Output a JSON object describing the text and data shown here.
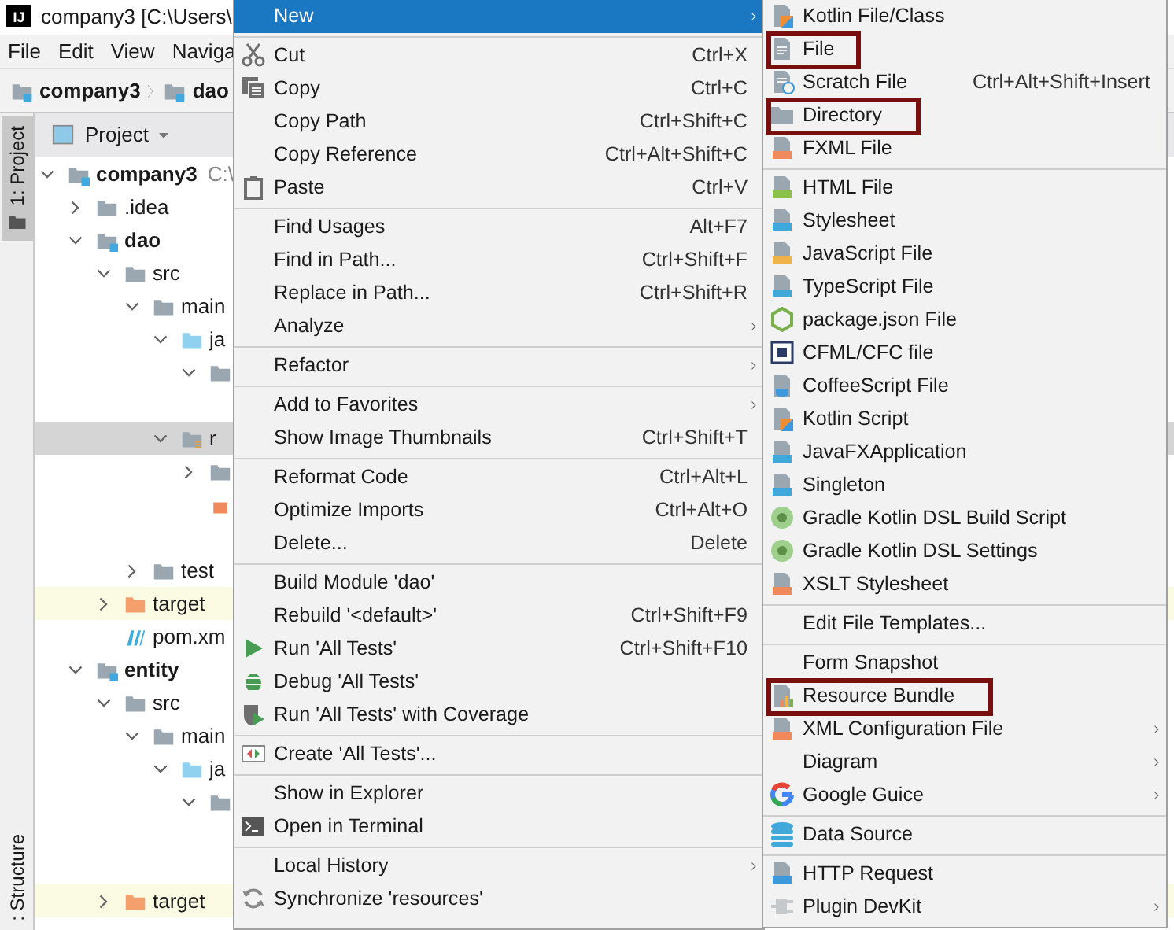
{
  "window": {
    "logo": "IJ",
    "title": "company3 [C:\\Users\\"
  },
  "menubar": [
    "File",
    "Edit",
    "View",
    "Naviga"
  ],
  "breadcrumb": [
    "company3",
    "dao"
  ],
  "tool_windows": [
    {
      "label": "1: Project",
      "selected": true
    },
    {
      "label": ": Structure",
      "selected": false
    }
  ],
  "project_panel": {
    "title": "Project"
  },
  "tree": [
    {
      "label": "company3",
      "suffix": "C:\\",
      "kind": "module",
      "expanded": true,
      "selected": false,
      "children": [
        {
          "label": ".idea",
          "kind": "folder",
          "expanded": false,
          "selected": false
        },
        {
          "label": "dao",
          "kind": "module",
          "expanded": true,
          "selected": false,
          "children": [
            {
              "label": "src",
              "kind": "folder",
              "expanded": true,
              "selected": false,
              "children": [
                {
                  "label": "main",
                  "kind": "folder",
                  "expanded": true,
                  "selected": false,
                  "children": [
                    {
                      "label": "ja",
                      "kind": "source",
                      "expanded": true,
                      "selected": false,
                      "children": [
                        {
                          "kind": "folder",
                          "expanded": true,
                          "selected": false,
                          "children": [
                            {
                              "selected": false
                            }
                          ]
                        }
                      ]
                    },
                    {
                      "label": "r",
                      "kind": "resources",
                      "expanded": true,
                      "selected": true,
                      "children": [
                        {
                          "kind": "folder",
                          "expanded": false,
                          "selected": false
                        },
                        {
                          "kind": "properties",
                          "selected": false
                        },
                        {
                          "selected": false
                        }
                      ]
                    }
                  ]
                },
                {
                  "label": "test",
                  "kind": "folder",
                  "expanded": false,
                  "selected": false
                }
              ]
            },
            {
              "label": "target",
              "kind": "excluded",
              "expanded": false,
              "selected": false
            },
            {
              "label": "pom.xm",
              "kind": "maven",
              "selected": false
            }
          ]
        },
        {
          "label": "entity",
          "kind": "module",
          "expanded": true,
          "selected": false,
          "children": [
            {
              "label": "src",
              "kind": "folder",
              "expanded": true,
              "selected": false,
              "children": [
                {
                  "label": "main",
                  "kind": "folder",
                  "expanded": true,
                  "selected": false,
                  "children": [
                    {
                      "label": "ja",
                      "kind": "source",
                      "expanded": true,
                      "selected": false,
                      "children": [
                        {
                          "kind": "folder",
                          "expanded": true,
                          "selected": false,
                          "children": [
                            {
                              "selected": false
                            },
                            {
                              "selected": false
                            }
                          ]
                        }
                      ]
                    }
                  ]
                }
              ]
            },
            {
              "label": "target",
              "kind": "excluded",
              "expanded": false,
              "selected": false
            }
          ]
        }
      ]
    }
  ],
  "context_menu": [
    [
      {
        "label": "New",
        "selected": true,
        "arrow": true
      }
    ],
    [
      {
        "label": "Cut",
        "shortcut": "Ctrl+X",
        "kind": "scissors",
        "selected": false
      },
      {
        "label": "Copy",
        "shortcut": "Ctrl+C",
        "kind": "copy",
        "selected": false
      },
      {
        "label": "Copy Path",
        "shortcut": "Ctrl+Shift+C",
        "selected": false
      },
      {
        "label": "Copy Reference",
        "shortcut": "Ctrl+Alt+Shift+C",
        "selected": false
      },
      {
        "label": "Paste",
        "shortcut": "Ctrl+V",
        "kind": "paste",
        "selected": false
      }
    ],
    [
      {
        "label": "Find Usages",
        "shortcut": "Alt+F7",
        "selected": false
      },
      {
        "label": "Find in Path...",
        "shortcut": "Ctrl+Shift+F",
        "selected": false
      },
      {
        "label": "Replace in Path...",
        "shortcut": "Ctrl+Shift+R",
        "selected": false
      },
      {
        "label": "Analyze",
        "arrow": true,
        "selected": false
      }
    ],
    [
      {
        "label": "Refactor",
        "arrow": true,
        "selected": false
      }
    ],
    [
      {
        "label": "Add to Favorites",
        "arrow": true,
        "selected": false
      },
      {
        "label": "Show Image Thumbnails",
        "shortcut": "Ctrl+Shift+T",
        "selected": false
      }
    ],
    [
      {
        "label": "Reformat Code",
        "shortcut": "Ctrl+Alt+L",
        "selected": false
      },
      {
        "label": "Optimize Imports",
        "shortcut": "Ctrl+Alt+O",
        "selected": false
      },
      {
        "label": "Delete...",
        "shortcut": "Delete",
        "selected": false
      }
    ],
    [
      {
        "label": "Build Module 'dao'",
        "selected": false
      },
      {
        "label": "Rebuild '<default>'",
        "shortcut": "Ctrl+Shift+F9",
        "selected": false
      },
      {
        "label": "Run 'All Tests'",
        "shortcut": "Ctrl+Shift+F10",
        "kind": "run",
        "selected": false
      },
      {
        "label": "Debug 'All Tests'",
        "kind": "debug",
        "selected": false
      },
      {
        "label": "Run 'All Tests' with Coverage",
        "kind": "coverage",
        "selected": false
      }
    ],
    [
      {
        "label": "Create 'All Tests'...",
        "kind": "create",
        "selected": false
      }
    ],
    [
      {
        "label": "Show in Explorer",
        "selected": false
      },
      {
        "label": "Open in Terminal",
        "kind": "terminal",
        "selected": false
      }
    ],
    [
      {
        "label": "Local History",
        "arrow": true,
        "selected": false
      },
      {
        "label": "Synchronize 'resources'",
        "kind": "sync",
        "selected": false
      }
    ]
  ],
  "new_submenu": [
    [
      {
        "label": "Kotlin File/Class",
        "kind": "kotlin"
      },
      {
        "label": "File",
        "kind": "file",
        "boxed": true
      },
      {
        "label": "Scratch File",
        "shortcut": "Ctrl+Alt+Shift+Insert",
        "kind": "scratch"
      },
      {
        "label": "Directory",
        "kind": "directory",
        "boxed": true
      },
      {
        "label": "FXML File",
        "kind": "fxml"
      }
    ],
    [
      {
        "label": "HTML File",
        "kind": "html"
      },
      {
        "label": "Stylesheet",
        "kind": "css"
      },
      {
        "label": "JavaScript File",
        "kind": "js"
      },
      {
        "label": "TypeScript File",
        "kind": "ts"
      },
      {
        "label": "package.json File",
        "kind": "nodejs"
      },
      {
        "label": "CFML/CFC file",
        "kind": "cfml"
      },
      {
        "label": "CoffeeScript File",
        "kind": "coffee"
      },
      {
        "label": "Kotlin Script",
        "kind": "kotlin"
      },
      {
        "label": "JavaFXApplication",
        "kind": "javafx"
      },
      {
        "label": "Singleton",
        "kind": "javafx"
      },
      {
        "label": "Gradle Kotlin DSL Build Script",
        "kind": "gradle"
      },
      {
        "label": "Gradle Kotlin DSL Settings",
        "kind": "gradle"
      },
      {
        "label": "XSLT Stylesheet",
        "kind": "fxml"
      }
    ],
    [
      {
        "label": "Edit File Templates..."
      }
    ],
    [
      {
        "label": "Form Snapshot"
      },
      {
        "label": "Resource Bundle",
        "kind": "bundle",
        "boxed": true
      },
      {
        "label": "XML Configuration File",
        "kind": "fxml",
        "arrow": true
      },
      {
        "label": "Diagram",
        "arrow": true
      },
      {
        "label": "Google Guice",
        "kind": "google",
        "arrow": true
      }
    ],
    [
      {
        "label": "Data Source",
        "kind": "database"
      }
    ],
    [
      {
        "label": "HTTP Request",
        "kind": "api"
      },
      {
        "label": "Plugin DevKit",
        "kind": "plugin",
        "arrow": true
      }
    ]
  ]
}
